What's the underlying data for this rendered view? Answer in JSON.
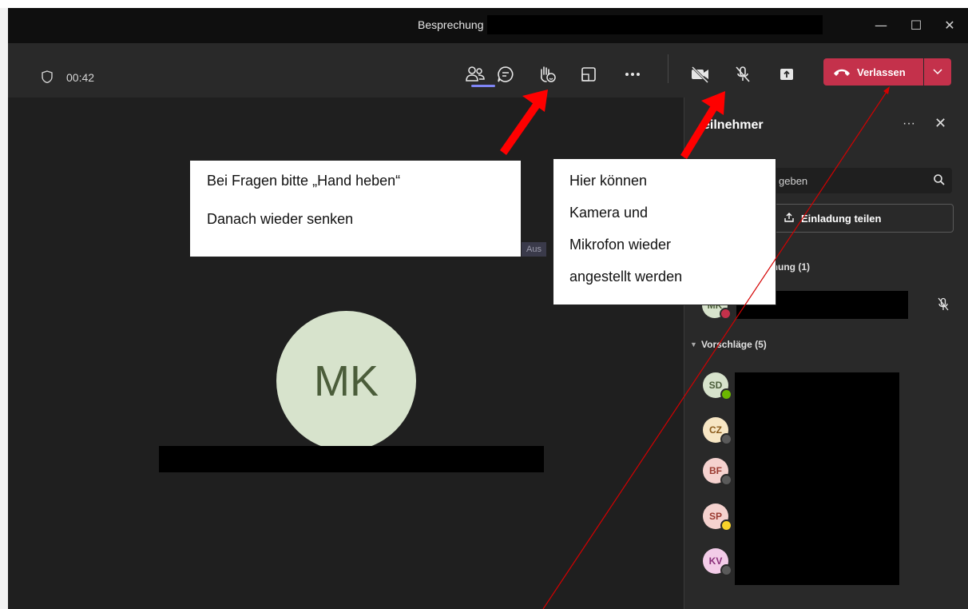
{
  "window": {
    "title": "Besprechung",
    "controls": {
      "minimize": "—",
      "maximize": "☐",
      "close": "✕"
    }
  },
  "toolbar": {
    "timer": "00:42",
    "icons": [
      "participants-icon",
      "chat-icon",
      "raise-hand-icon",
      "layout-icon",
      "more-icon",
      "camera-off-icon",
      "mic-off-icon",
      "share-tray-icon"
    ],
    "leave_label": "Verlassen",
    "leave_color": "#c4314b"
  },
  "stage": {
    "avatar_initials": "MK",
    "ghost_label": "Aus"
  },
  "panel": {
    "title": "eilnehmer",
    "search_placeholder": "geben",
    "invite_label": "Einladung teilen",
    "in_meeting_label": "chung (1)",
    "suggestions_label": "Vorschläge (5)",
    "in_meeting": [
      {
        "initials": "MK",
        "status": "busy"
      }
    ],
    "suggestions": [
      {
        "initials": "SD",
        "status": "available"
      },
      {
        "initials": "CZ",
        "status": "offline"
      },
      {
        "initials": "BF",
        "status": "offline"
      },
      {
        "initials": "SP",
        "status": "away"
      },
      {
        "initials": "KV",
        "status": "offline"
      }
    ]
  },
  "callouts": {
    "hand": {
      "line1": "Bei Fragen bitte „Hand heben“",
      "line2": "Danach wieder senken"
    },
    "camera": {
      "line1": "Hier können",
      "line2": "Kamera und",
      "line3": "Mikrofon wieder",
      "line4": "angestellt werden"
    }
  },
  "colors": {
    "accent": "#7f85f5",
    "arrow": "#ff0000",
    "available": "#6bb700",
    "busy": "#c4314b",
    "away": "#f8d22a"
  }
}
